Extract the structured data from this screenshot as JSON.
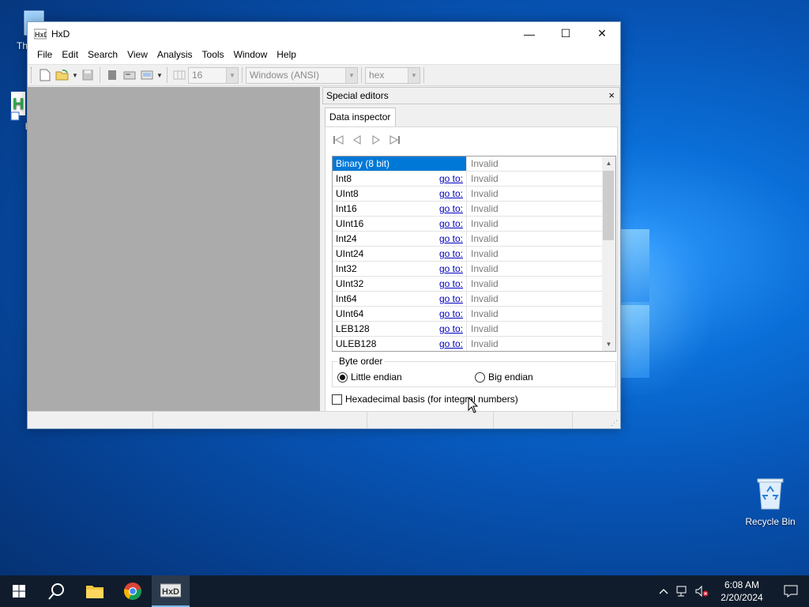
{
  "desktop": {
    "recycle_bin_label": "Recycle Bin",
    "icon_partial_1": "Th",
    "icon_partial_2": "H"
  },
  "window": {
    "title": "HxD",
    "controls": {
      "minimize": "—",
      "maximize": "☐",
      "close": "✕"
    },
    "menu": [
      "File",
      "Edit",
      "Search",
      "View",
      "Analysis",
      "Tools",
      "Window",
      "Help"
    ],
    "toolbar": {
      "bytes_per_row": "16",
      "charset": "Windows (ANSI)",
      "offset_base": "hex"
    }
  },
  "special_editors": {
    "title": "Special editors",
    "close": "×",
    "tab_label": "Data inspector",
    "rows": [
      {
        "name": "Binary (8 bit)",
        "goto": "",
        "value": "Invalid",
        "selected": true
      },
      {
        "name": "Int8",
        "goto": "go to:",
        "value": "Invalid"
      },
      {
        "name": "UInt8",
        "goto": "go to:",
        "value": "Invalid"
      },
      {
        "name": "Int16",
        "goto": "go to:",
        "value": "Invalid"
      },
      {
        "name": "UInt16",
        "goto": "go to:",
        "value": "Invalid"
      },
      {
        "name": "Int24",
        "goto": "go to:",
        "value": "Invalid"
      },
      {
        "name": "UInt24",
        "goto": "go to:",
        "value": "Invalid"
      },
      {
        "name": "Int32",
        "goto": "go to:",
        "value": "Invalid"
      },
      {
        "name": "UInt32",
        "goto": "go to:",
        "value": "Invalid"
      },
      {
        "name": "Int64",
        "goto": "go to:",
        "value": "Invalid"
      },
      {
        "name": "UInt64",
        "goto": "go to:",
        "value": "Invalid"
      },
      {
        "name": "LEB128",
        "goto": "go to:",
        "value": "Invalid"
      },
      {
        "name": "ULEB128",
        "goto": "go to:",
        "value": "Invalid"
      }
    ],
    "byte_order": {
      "legend": "Byte order",
      "little": "Little endian",
      "big": "Big endian",
      "selected": "little"
    },
    "hex_basis_label": "Hexadecimal basis (for integral numbers)"
  },
  "taskbar": {
    "time": "6:08 AM",
    "date": "2/20/2024"
  },
  "colors": {
    "accent": "#0078d7",
    "link": "#0000c0",
    "taskbar": "#101c2c"
  }
}
